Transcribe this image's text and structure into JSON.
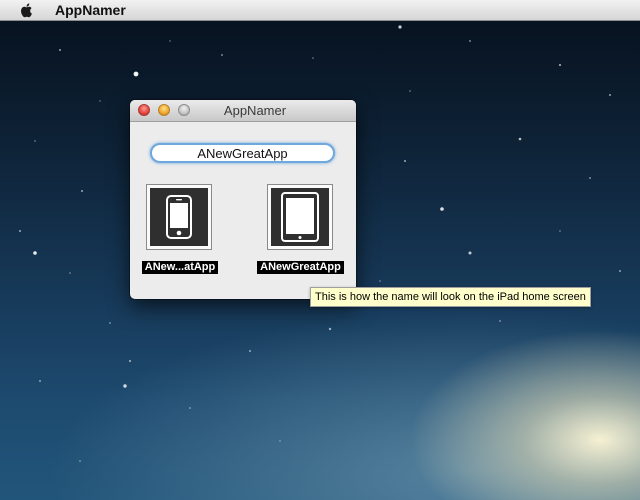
{
  "menubar": {
    "apple_icon": "apple-logo-icon",
    "app_name": "AppNamer"
  },
  "window": {
    "title": "AppNamer",
    "buttons": [
      "close",
      "minimize",
      "zoom"
    ],
    "name_field": {
      "value": "ANewGreatApp",
      "placeholder": ""
    },
    "previews": [
      {
        "device": "iphone",
        "icon": "iphone-icon",
        "label": "ANew...atApp"
      },
      {
        "device": "ipad",
        "icon": "ipad-icon",
        "label": "ANewGreatApp"
      }
    ]
  },
  "tooltip": {
    "text": "This is how the name will look on the iPad home screen"
  },
  "colors": {
    "focus_ring": "#6fa8dc",
    "tooltip_bg": "#ffffcc",
    "label_bg": "#000000",
    "label_text": "#ffffff"
  }
}
